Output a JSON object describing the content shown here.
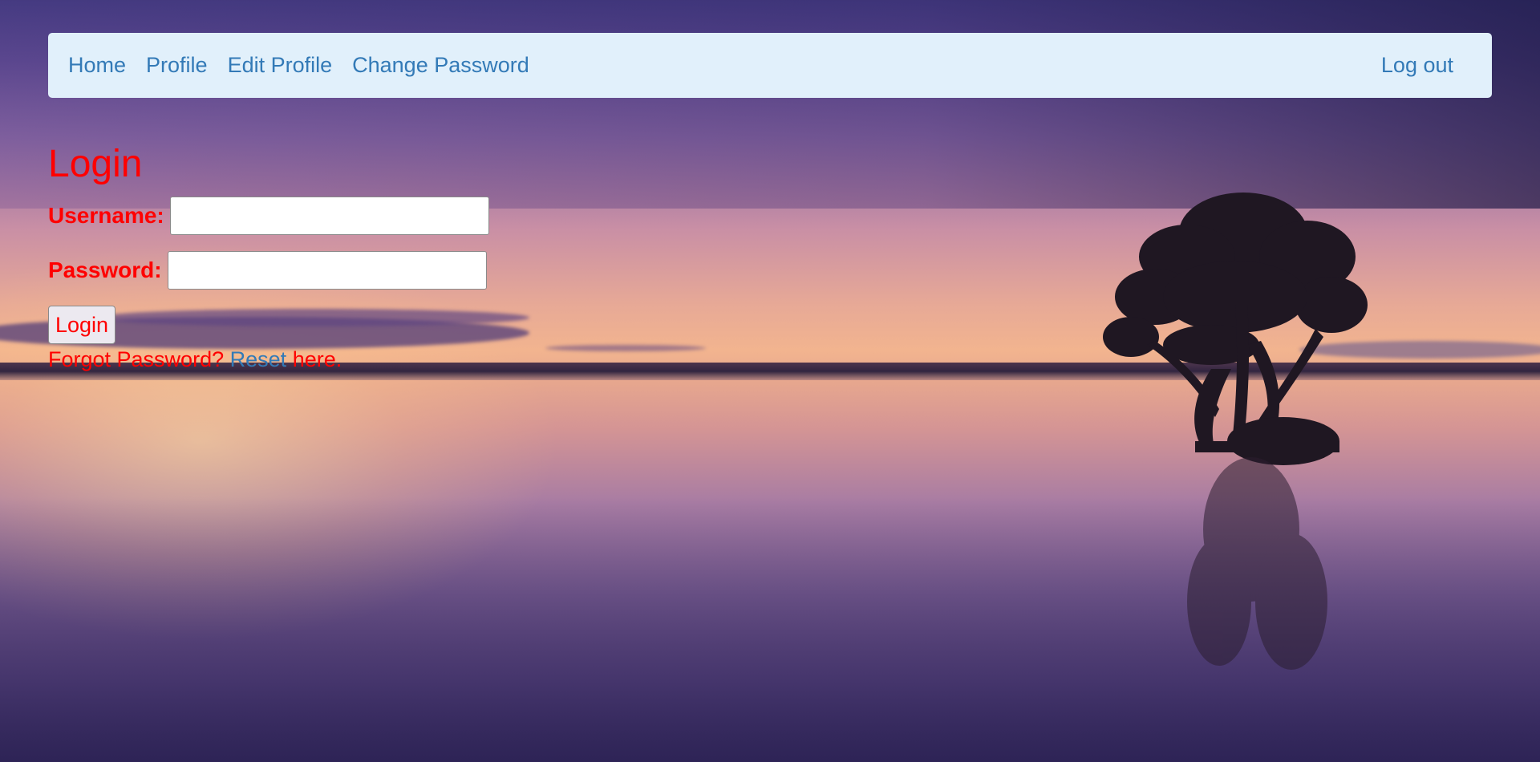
{
  "nav": {
    "items": [
      {
        "label": "Home"
      },
      {
        "label": "Profile"
      },
      {
        "label": "Edit Profile"
      },
      {
        "label": "Change Password"
      }
    ],
    "logout_label": "Log out"
  },
  "login": {
    "title": "Login",
    "username_label": "Username:",
    "username_value": "",
    "password_label": "Password:",
    "password_value": "",
    "submit_label": "Login",
    "forgot_text": "Forgot Password?",
    "reset_link_text": "Reset",
    "reset_suffix": "here."
  },
  "colors": {
    "nav_bg": "#e1f0fb",
    "link": "#337ab7",
    "accent_red": "#ff0000"
  },
  "background": {
    "icon": "sunset-lake-tree-image"
  }
}
